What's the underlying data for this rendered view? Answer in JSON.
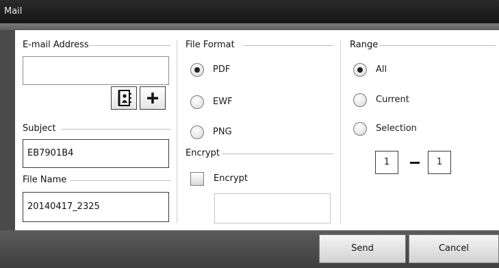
{
  "window": {
    "title": "Mail"
  },
  "email": {
    "group_label": "E-mail Address",
    "value": "",
    "address_book_icon": "address-book-icon",
    "add_icon": "plus-icon"
  },
  "subject": {
    "group_label": "Subject",
    "value": "EB7901B4"
  },
  "file_name": {
    "group_label": "File Name",
    "value": "20140417_2325"
  },
  "file_format": {
    "group_label": "File Format",
    "options": [
      "PDF",
      "EWF",
      "PNG"
    ],
    "selected": "PDF"
  },
  "encrypt": {
    "group_label": "Encrypt",
    "checkbox_label": "Encrypt",
    "checked": false,
    "password": ""
  },
  "range": {
    "group_label": "Range",
    "options": [
      "All",
      "Current",
      "Selection"
    ],
    "selected": "All",
    "from": "1",
    "to": "1"
  },
  "buttons": {
    "send": "Send",
    "cancel": "Cancel"
  }
}
